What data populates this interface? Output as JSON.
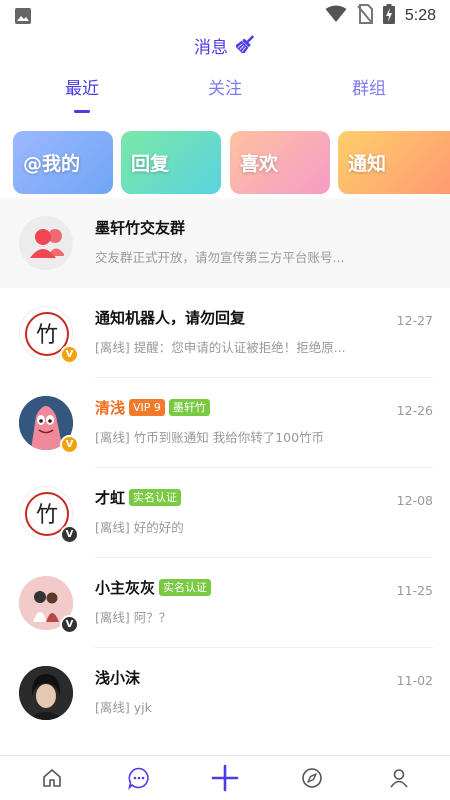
{
  "status_bar": {
    "time": "5:28",
    "icons": [
      "gallery-icon",
      "wifi-icon",
      "no-sim-icon",
      "battery-charging-icon"
    ]
  },
  "header": {
    "title": "消息",
    "action_icon": "broom-icon"
  },
  "tabs": [
    {
      "label": "最近",
      "active": true
    },
    {
      "label": "关注",
      "active": false
    },
    {
      "label": "群组",
      "active": false
    }
  ],
  "quick_cards": [
    {
      "label": "@我的"
    },
    {
      "label": "回复"
    },
    {
      "label": "喜欢"
    },
    {
      "label": "通知"
    }
  ],
  "group": {
    "name": "墨轩竹交友群",
    "preview": "交友群正式开放，请勿宣传第三方平台账号..."
  },
  "chats": [
    {
      "name": "通知机器人，请勿回复",
      "tags": [],
      "preview": "[离线] 提醒：您申请的认证被拒绝！拒绝原...",
      "time": "12-27",
      "avatar": "bamboo-logo",
      "badge": "vip-v"
    },
    {
      "name": "清浅",
      "tags": [
        "VIP 9",
        "墨轩竹"
      ],
      "preview": "[离线] 竹币到账通知 我给你转了100竹币",
      "time": "12-26",
      "avatar": "cartoon-starfish",
      "badge": "vip-v"
    },
    {
      "name": "才虹",
      "tags": [
        "实名认证"
      ],
      "preview": "[离线] 好的好的",
      "time": "12-08",
      "avatar": "bamboo-logo",
      "badge": "verified-v"
    },
    {
      "name": "小主灰灰",
      "tags": [
        "实名认证"
      ],
      "preview": "[离线] 阿？？",
      "time": "11-25",
      "avatar": "couple-illustration",
      "badge": "verified-v"
    },
    {
      "name": "浅小沫",
      "tags": [],
      "preview": "[离线] yjk",
      "time": "11-02",
      "avatar": "portrait-photo",
      "badge": ""
    }
  ],
  "bottom_nav": [
    {
      "icon": "home-icon"
    },
    {
      "icon": "chat-bubble-icon",
      "active": true
    },
    {
      "icon": "plus-icon"
    },
    {
      "icon": "compass-icon"
    },
    {
      "icon": "user-icon"
    }
  ],
  "colors": {
    "accent": "#4a3ce6",
    "vip_tag": "#f27a2c",
    "green_tag": "#7ac943",
    "vip_badge": "#f2a20c",
    "verified_badge": "#333333"
  }
}
